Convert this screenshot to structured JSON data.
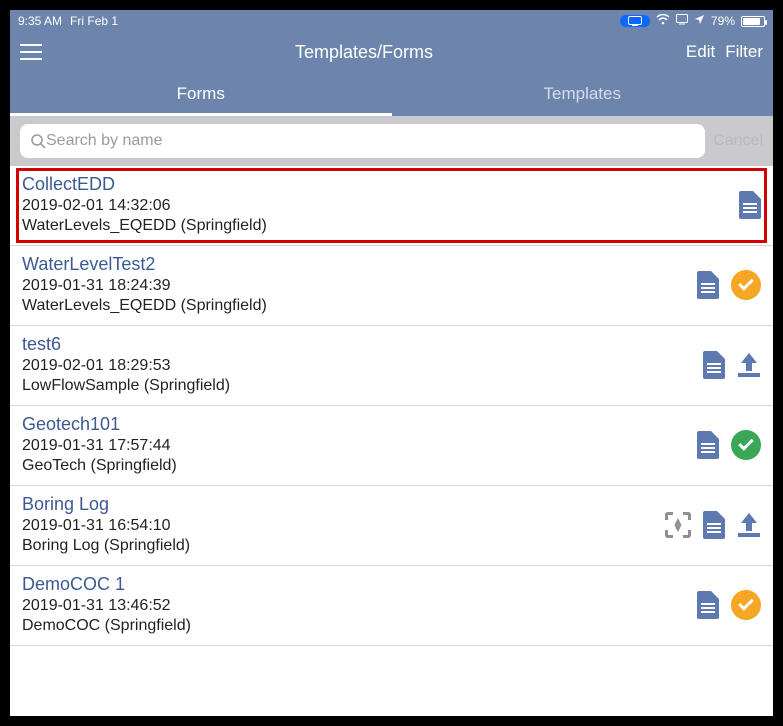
{
  "statusbar": {
    "time": "9:35 AM",
    "date": "Fri Feb 1",
    "battery_pct": "79%"
  },
  "navbar": {
    "title": "Templates/Forms",
    "edit": "Edit",
    "filter": "Filter"
  },
  "tabs": {
    "forms": "Forms",
    "templates": "Templates"
  },
  "search": {
    "placeholder": "Search by name",
    "cancel": "Cancel"
  },
  "rows": [
    {
      "title": "CollectEDD",
      "ts": "2019-02-01 14:32:06",
      "sub": "WaterLevels_EQEDD (Springfield)",
      "highlighted": true,
      "icons": [
        "doc"
      ]
    },
    {
      "title": "WaterLevelTest2",
      "ts": "2019-01-31 18:24:39",
      "sub": "WaterLevels_EQEDD (Springfield)",
      "icons": [
        "doc",
        "check-orange"
      ]
    },
    {
      "title": "test6",
      "ts": "2019-02-01 18:29:53",
      "sub": "LowFlowSample (Springfield)",
      "icons": [
        "doc",
        "upload"
      ]
    },
    {
      "title": "Geotech101",
      "ts": "2019-01-31 17:57:44",
      "sub": "GeoTech (Springfield)",
      "icons": [
        "doc",
        "check-green"
      ]
    },
    {
      "title": "Boring Log",
      "ts": "2019-01-31 16:54:10",
      "sub": "Boring Log (Springfield)",
      "icons": [
        "scan",
        "doc",
        "upload"
      ]
    },
    {
      "title": "DemoCOC 1",
      "ts": "2019-01-31 13:46:52",
      "sub": "DemoCOC (Springfield)",
      "icons": [
        "doc",
        "check-orange"
      ]
    }
  ]
}
